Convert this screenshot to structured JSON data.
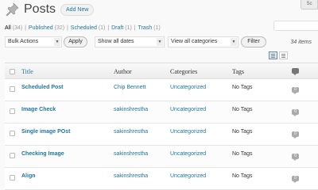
{
  "header": {
    "title": "Posts",
    "add_new": "Add New",
    "screen_options": "Sc"
  },
  "filters_links": [
    {
      "label": "All",
      "count": "(34)",
      "current": true
    },
    {
      "label": "Published",
      "count": "(32)"
    },
    {
      "label": "Scheduled",
      "count": "(1)"
    },
    {
      "label": "Draft",
      "count": "(1)"
    },
    {
      "label": "Trash",
      "count": "(1)"
    }
  ],
  "tablenav": {
    "bulk_actions": "Bulk Actions",
    "apply": "Apply",
    "dates": "Show all dates",
    "categories": "View all categories",
    "filter": "Filter",
    "items_count": "34 items"
  },
  "columns": {
    "title": "Title",
    "author": "Author",
    "categories": "Categories",
    "tags": "Tags"
  },
  "rows": [
    {
      "title": "Scheduled Post",
      "author": "Chip Bennett",
      "category": "Uncategorized",
      "tags": "No Tags",
      "comments": "0"
    },
    {
      "title": "Image Check",
      "author": "sakinshrestha",
      "category": "Uncategorized",
      "tags": "No Tags",
      "comments": "0"
    },
    {
      "title": "Single image POst",
      "author": "sakinshrestha",
      "category": "Uncategorized",
      "tags": "No Tags",
      "comments": "0"
    },
    {
      "title": "Checking Image",
      "author": "sakinshrestha",
      "category": "Uncategorized",
      "tags": "No Tags",
      "comments": "0"
    },
    {
      "title": "Align",
      "author": "sakinshrestha",
      "category": "Uncategorized",
      "tags": "No Tags",
      "comments": "0"
    }
  ],
  "icons": {
    "header": "pushpin-icon",
    "comments_header": "comment-bubble-icon",
    "list_view": "list-view-icon",
    "excerpt_view": "excerpt-view-icon"
  },
  "colors": {
    "link": "#21759b",
    "background": "#f9f9f9"
  }
}
